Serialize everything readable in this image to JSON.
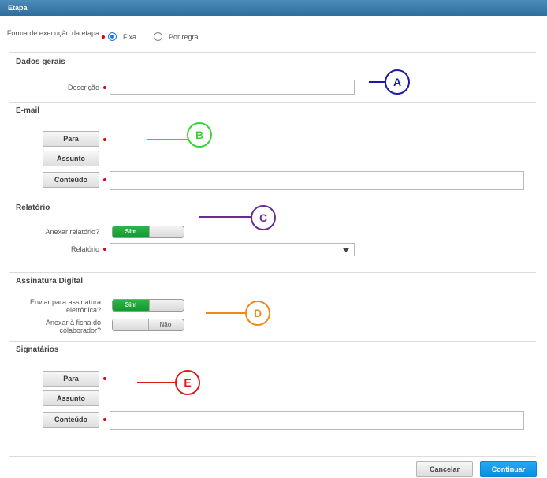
{
  "window": {
    "title": "Etapa"
  },
  "execucao": {
    "label": "Forma de execução da etapa",
    "options": [
      "Fixa",
      "Por regra"
    ],
    "selected": "Fixa"
  },
  "dados_gerais": {
    "title": "Dados gerais",
    "descricao_label": "Descrição",
    "descricao_value": ""
  },
  "email": {
    "title": "E-mail",
    "para_label": "Para",
    "assunto_label": "Assunto",
    "conteudo_label": "Conteúdo"
  },
  "relatorio": {
    "title": "Relatório",
    "anexar_label": "Anexar relatório?",
    "anexar_value": "Sim",
    "relatorio_label": "Relatório",
    "relatorio_value": ""
  },
  "assinatura": {
    "title": "Assinatura Digital",
    "enviar_label": "Enviar para assinatura eletrônica?",
    "enviar_value": "Sim",
    "anexar_ficha_label": "Anexar à ficha do colaborador?",
    "anexar_ficha_value": "Não"
  },
  "signatarios": {
    "title": "Signatários",
    "para_label": "Para",
    "assunto_label": "Assunto",
    "conteudo_label": "Conteúdo"
  },
  "callouts": {
    "a": {
      "label": "A",
      "color": "#1a1aa8"
    },
    "b": {
      "label": "B",
      "color": "#33d633"
    },
    "c": {
      "label": "C",
      "color": "#6b2c8f"
    },
    "d": {
      "label": "D",
      "color": "#f08a1c"
    },
    "e": {
      "label": "E",
      "color": "#e01818"
    }
  },
  "footer": {
    "cancel_label": "Cancelar",
    "continue_label": "Continuar"
  }
}
